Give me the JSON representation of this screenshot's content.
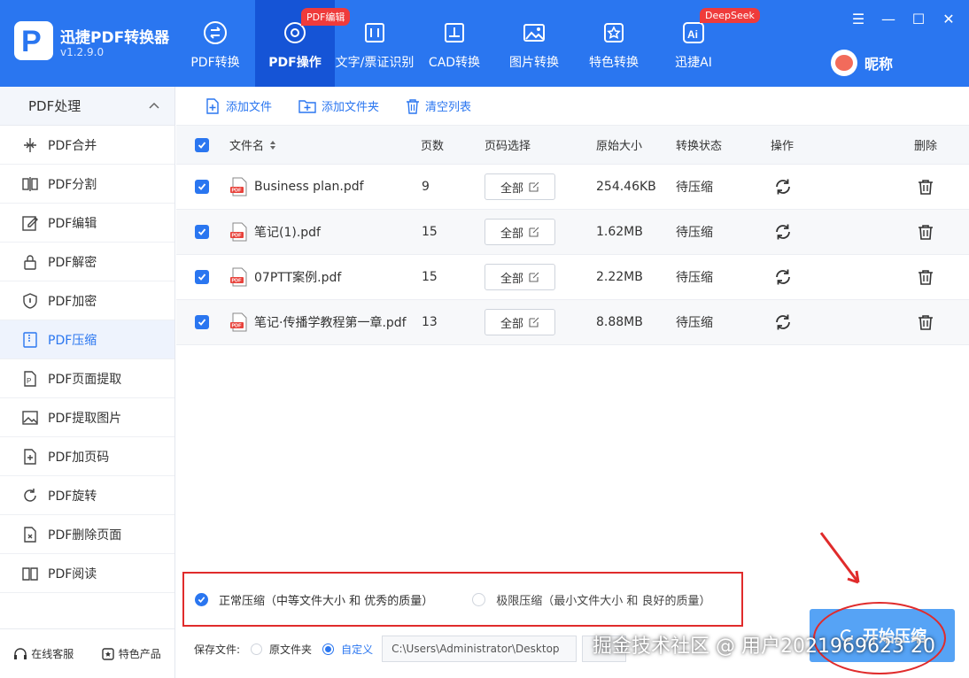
{
  "app": {
    "title": "迅捷PDF转换器",
    "version": "v1.2.9.0",
    "logo_icon": "p-logo-icon"
  },
  "nav": [
    {
      "label": "PDF转换",
      "icon": "pdf-convert-icon",
      "active": false
    },
    {
      "label": "PDF操作",
      "icon": "pdf-operate-icon",
      "active": true,
      "badge": "PDF编辑"
    },
    {
      "label": "文字/票证识别",
      "icon": "ocr-icon",
      "active": false
    },
    {
      "label": "CAD转换",
      "icon": "cad-icon",
      "active": false
    },
    {
      "label": "图片转换",
      "icon": "image-icon",
      "active": false
    },
    {
      "label": "特色转换",
      "icon": "star-convert-icon",
      "active": false
    },
    {
      "label": "迅捷AI",
      "icon": "ai-icon",
      "active": false,
      "badge": "DeepSeek"
    }
  ],
  "user": {
    "name": "昵称"
  },
  "window": {
    "menu": "☰",
    "minimize": "—",
    "maximize": "☐",
    "close": "✕"
  },
  "sidebar": {
    "section": "PDF处理",
    "items": [
      {
        "label": "PDF合并",
        "icon": "merge-icon"
      },
      {
        "label": "PDF分割",
        "icon": "split-icon"
      },
      {
        "label": "PDF编辑",
        "icon": "edit-icon"
      },
      {
        "label": "PDF解密",
        "icon": "unlock-icon"
      },
      {
        "label": "PDF加密",
        "icon": "shield-icon"
      },
      {
        "label": "PDF压缩",
        "icon": "compress-icon",
        "active": true
      },
      {
        "label": "PDF页面提取",
        "icon": "page-extract-icon"
      },
      {
        "label": "PDF提取图片",
        "icon": "image-extract-icon"
      },
      {
        "label": "PDF加页码",
        "icon": "page-number-icon"
      },
      {
        "label": "PDF旋转",
        "icon": "rotate-icon"
      },
      {
        "label": "PDF删除页面",
        "icon": "delete-page-icon"
      },
      {
        "label": "PDF阅读",
        "icon": "book-icon"
      }
    ],
    "footer": [
      {
        "label": "在线客服",
        "icon": "headset-icon"
      },
      {
        "label": "特色产品",
        "icon": "product-icon"
      }
    ]
  },
  "toolbar": {
    "add_file": "添加文件",
    "add_folder": "添加文件夹",
    "clear_list": "清空列表"
  },
  "table": {
    "headers": {
      "name": "文件名",
      "pages": "页数",
      "page_select": "页码选择",
      "size": "原始大小",
      "status": "转换状态",
      "action": "操作",
      "delete": "删除"
    },
    "rows": [
      {
        "name": "Business plan.pdf",
        "pages": "9",
        "page_select": "全部",
        "size": "254.46KB",
        "status": "待压缩"
      },
      {
        "name": "笔记(1).pdf",
        "pages": "15",
        "page_select": "全部",
        "size": "1.62MB",
        "status": "待压缩"
      },
      {
        "name": "07PTT案例.pdf",
        "pages": "15",
        "page_select": "全部",
        "size": "2.22MB",
        "status": "待压缩"
      },
      {
        "name": "笔记·传播学教程第一章.pdf",
        "pages": "13",
        "page_select": "全部",
        "size": "8.88MB",
        "status": "待压缩"
      }
    ]
  },
  "compression": {
    "normal": "正常压缩（中等文件大小 和 优秀的质量）",
    "extreme": "极限压缩（最小文件大小 和 良好的质量）",
    "selected": "normal"
  },
  "save": {
    "label": "保存文件:",
    "original": "原文件夹",
    "custom": "自定义",
    "path": "C:\\Users\\Administrator\\Desktop",
    "selected": "custom"
  },
  "start_button": "开始压缩",
  "watermark": "掘金技术社区 @ 用户2021969623 20",
  "colors": {
    "brand": "#2a76f0",
    "active_nav": "#1554d6",
    "badge": "#ef3b3b",
    "highlight": "#e02b2b"
  }
}
